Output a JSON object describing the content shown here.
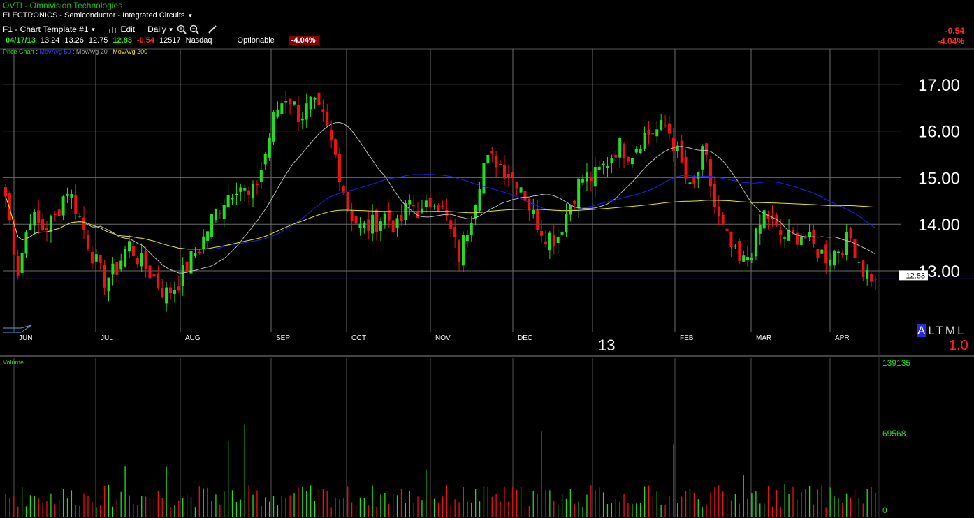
{
  "header": {
    "title": "OVTI - Omnivision Technologies",
    "sector": "ELECTRONICS - Semiconductor - Integrated Circuits",
    "template": "F1 - Chart Template #1",
    "edit_label": "Edit",
    "period_label": "Daily"
  },
  "quote": {
    "date": "04/17/13",
    "open": "13.24",
    "high": "13.26",
    "low": "12.75",
    "last": "12.83",
    "change": "-0.54",
    "volume": "12517",
    "exchange": "Nasdaq",
    "optionable": "Optionable",
    "pct_change": "-4.04%"
  },
  "right_change": {
    "change": "-0.54",
    "pct": "-4.04%"
  },
  "legend": {
    "price": "Price Chart",
    "ma50": "MovAvg 50",
    "ma20": "MovAvg 20",
    "ma200": "MovAvg 200",
    "sep": " : "
  },
  "scale_buttons": {
    "a": "A",
    "rest": "LTML"
  },
  "scale_value": "1.0",
  "colors": {
    "up": "#22dd22",
    "down": "#ee1111",
    "ma50": "#1c1cff",
    "ma20": "#bdbdbd",
    "ma200": "#e8e800",
    "grid": "#6b6b6b",
    "last_line": "#2a2aff"
  },
  "chart_data": {
    "type": "candlestick",
    "y_ticks": [
      "17.00",
      "16.00",
      "15.00",
      "14.00",
      "13.00"
    ],
    "ylim": [
      12.2,
      17.9
    ],
    "months": [
      "JUN",
      "JUL",
      "AUG",
      "SEP",
      "OCT",
      "NOV",
      "DEC",
      "13",
      "FEB",
      "MAR",
      "APR"
    ],
    "last_price_label": "12.83",
    "last_price": 12.83,
    "volume": {
      "label": "Volume",
      "ticks": [
        "139135",
        "69568",
        "0"
      ],
      "max": 139135
    },
    "ohlc_close_path": [
      14.6,
      13.0,
      14.2,
      13.9,
      14.1,
      14.8,
      14.2,
      13.4,
      12.8,
      13.0,
      13.6,
      13.2,
      12.9,
      12.5,
      12.7,
      13.2,
      13.6,
      14.2,
      14.6,
      14.9,
      14.5,
      15.3,
      16.4,
      16.8,
      16.3,
      16.6,
      16.2,
      15.4,
      14.3,
      13.9,
      14.0,
      14.2,
      13.9,
      14.5,
      14.2,
      14.6,
      14.1,
      13.3,
      14.2,
      15.3,
      15.4,
      15.1,
      14.9,
      14.2,
      13.8,
      13.7,
      14.4,
      15.0,
      15.0,
      15.3,
      15.7,
      15.5,
      15.9,
      16.0,
      16.1,
      15.4,
      14.6,
      15.6,
      14.2,
      13.6,
      13.1,
      13.5,
      14.3,
      13.8,
      13.7,
      13.8,
      13.5,
      13.3,
      13.5,
      13.7,
      13.0,
      12.83
    ]
  }
}
